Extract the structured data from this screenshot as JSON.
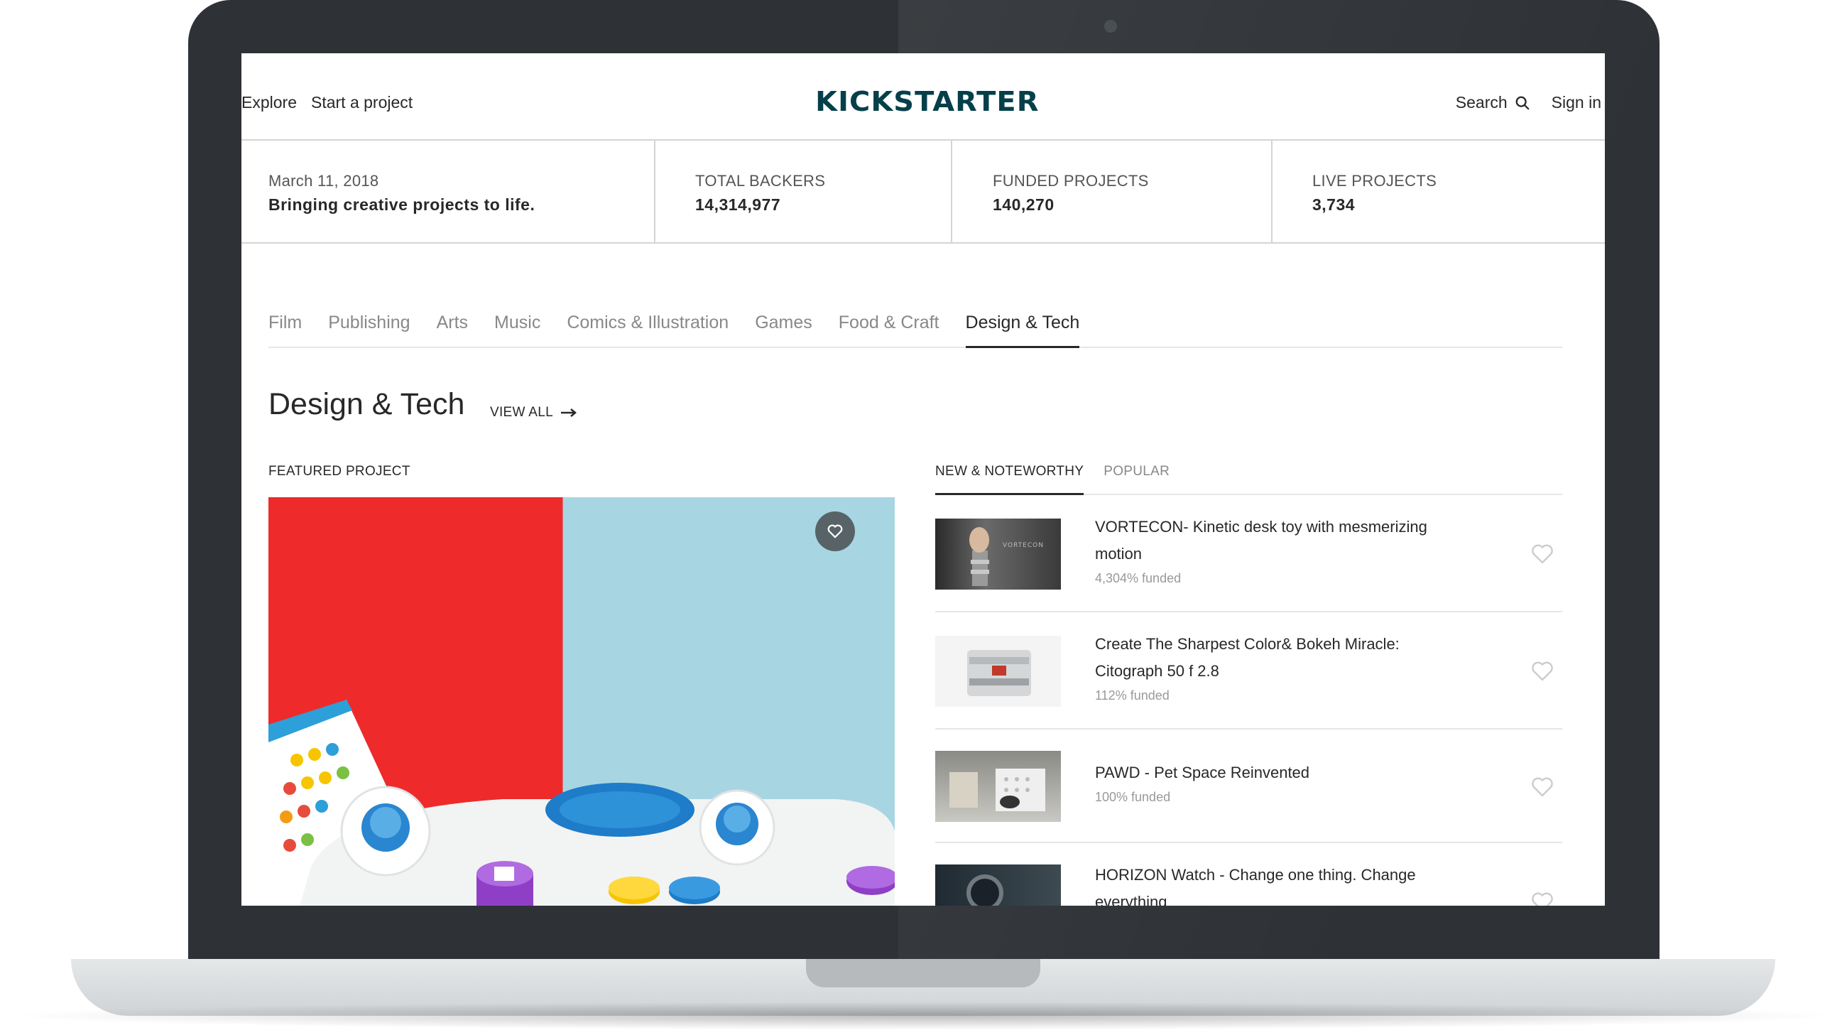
{
  "header": {
    "nav_left": [
      "Explore",
      "Start a project"
    ],
    "logo_text": "KICKSTARTER",
    "search_label": "Search",
    "signin_label": "Sign in"
  },
  "stats": {
    "date": "March 11, 2018",
    "tagline": "Bringing creative projects to life.",
    "total_backers_label": "TOTAL BACKERS",
    "total_backers_value": "14,314,977",
    "funded_projects_label": "FUNDED PROJECTS",
    "funded_projects_value": "140,270",
    "live_projects_label": "LIVE PROJECTS",
    "live_projects_value": "3,734"
  },
  "categories": {
    "tabs": [
      "Film",
      "Publishing",
      "Arts",
      "Music",
      "Comics & Illustration",
      "Games",
      "Food & Craft",
      "Design & Tech"
    ],
    "active": "Design & Tech"
  },
  "section": {
    "title": "Design & Tech",
    "view_all": "VIEW ALL"
  },
  "featured": {
    "label": "FEATURED PROJECT"
  },
  "list_tabs": [
    "NEW & NOTEWORTHY",
    "POPULAR"
  ],
  "projects": [
    {
      "title": "VORTECON- Kinetic desk toy with mesmerizing motion",
      "funded": "4,304% funded",
      "thumb_text": "VORTECON"
    },
    {
      "title": "Create The Sharpest Color& Bokeh Miracle: Citograph 50 f 2.8",
      "funded": "112% funded"
    },
    {
      "title": "PAWD - Pet Space Reinvented",
      "funded": "100% funded"
    },
    {
      "title": "HORIZON Watch - Change one thing. Change everything",
      "funded": ""
    }
  ],
  "colors": {
    "brand": "#05404a",
    "text": "#282828",
    "muted": "#888888",
    "divider": "#d4d4d4"
  },
  "icons": [
    "search-icon",
    "arrow-right-icon",
    "heart-icon",
    "camera-icon"
  ]
}
